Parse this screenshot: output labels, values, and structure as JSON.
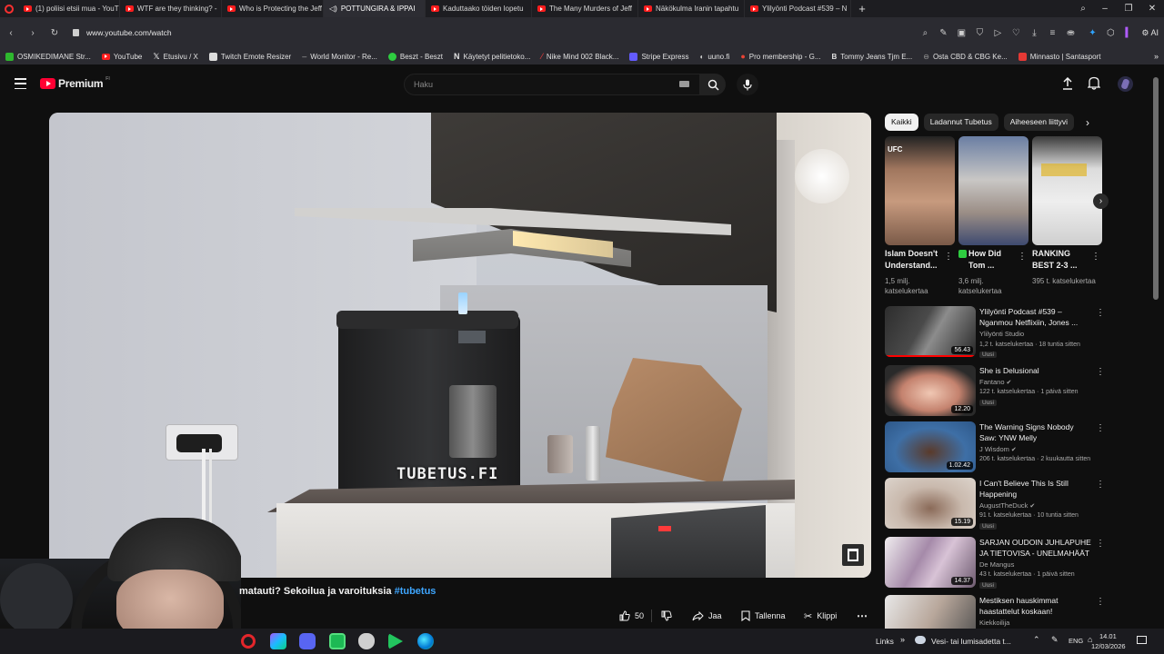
{
  "browser": {
    "tabs": [
      {
        "label": "(1) poliisi etsii mua - YouT",
        "active": false
      },
      {
        "label": "WTF are they thinking? -",
        "active": false
      },
      {
        "label": "Who is Protecting the Jeff",
        "active": false
      },
      {
        "label": "POTTUNGIRA & IPPAI",
        "active": true
      },
      {
        "label": "Kaduttaako töiden lopetu",
        "active": false
      },
      {
        "label": "The Many Murders of Jeff",
        "active": false
      },
      {
        "label": "Näkökulma Iranin tapahtu",
        "active": false
      },
      {
        "label": "Ylilyönti Podcast #539 – N",
        "active": false
      }
    ],
    "new_tab": "+",
    "url": "www.youtube.com/watch",
    "ai_label": "AI",
    "bookmarks": [
      {
        "label": "OSMIKEDIMANE Str...",
        "color": "#2eb82e"
      },
      {
        "label": "YouTube",
        "color": "#ff1d1d"
      },
      {
        "label": "Etusivu / X",
        "color": "#ffffff"
      },
      {
        "label": "Twitch Emote Resizer",
        "color": "#dddddd"
      },
      {
        "label": "World Monitor - Re...",
        "color": "#888888"
      },
      {
        "label": "Beszt - Beszt",
        "color": "#2ecc40"
      },
      {
        "label": "Käytetyt pelitietoko...",
        "color": "#ffffff"
      },
      {
        "label": "Nike Mind 002 Black...",
        "color": "#ff3b3b"
      },
      {
        "label": "Stripe Express",
        "color": "#635bff"
      },
      {
        "label": "uuno.fi",
        "color": "#cccccc"
      },
      {
        "label": "Pro membership - G...",
        "color": "#ea4335"
      },
      {
        "label": "Tommy Jeans Tjm E...",
        "color": "#ffffff"
      },
      {
        "label": "Osta CBD & CBG Ke...",
        "color": "#999999"
      },
      {
        "label": "Minnasto | Santasport",
        "color": "#e53935"
      }
    ]
  },
  "youtube": {
    "logo_text": "Premium",
    "logo_sup": "FI",
    "search_placeholder": "Haku",
    "video": {
      "overlay_text": "TUBETUS.FI",
      "title_prefix": "matauti? Sekoilua ja varoituksia",
      "title_hashtag": "#tubetus"
    },
    "actions": {
      "likes": "50",
      "share": "Jaa",
      "save": "Tallenna",
      "clip": "Klippi"
    },
    "chips": [
      "Kaikki",
      "Ladannut Tubetus",
      "Aiheeseen liittyvi"
    ],
    "shorts": [
      {
        "title": "Islam Doesn't Understand...",
        "views": "1,5 milj. katselukertaa"
      },
      {
        "title": "How Did Tom ...",
        "views": "3,6 milj. katselukertaa"
      },
      {
        "title": "RANKING BEST 2-3 ...",
        "views": "395 t. katselukertaa"
      }
    ],
    "recommended": [
      {
        "title": "Ylilyönti Podcast #539 – Nganmou Netflixiin, Jones ...",
        "channel": "Ylilyönti Studio",
        "meta": "1,2 t. katselukertaa · 18 tuntia sitten",
        "badge": "Uusi",
        "duration": "56.43",
        "thumb": "#3a3a3a"
      },
      {
        "title": "She is Delusional",
        "channel": "Fantano",
        "meta": "122 t. katselukertaa · 1 päivä sitten",
        "badge": "Uusi",
        "duration": "12.20",
        "thumb": "#b46a5c"
      },
      {
        "title": "The Warning Signs Nobody Saw: YNW Melly",
        "channel": "J Wisdom",
        "meta": "206 t. katselukertaa · 2 kuukautta sitten",
        "badge": "",
        "duration": "1.02.42",
        "thumb": "#3d6fa3"
      },
      {
        "title": "I Can't Believe This Is Still Happening",
        "channel": "AugustTheDuck",
        "meta": "91 t. katselukertaa · 10 tuntia sitten",
        "badge": "Uusi",
        "duration": "15.19",
        "thumb": "#7a6658"
      },
      {
        "title": "SARJAN OUDOIN JUHLAPUHE JA TIETOVISA - UNELMAHÄÄT",
        "channel": "De Mangus",
        "meta": "43 t. katselukertaa · 1 päivä sitten",
        "badge": "Uusi",
        "duration": "14.37",
        "thumb": "#8a6a8e"
      },
      {
        "title": "Mestiksen hauskimmat haastattelut koskaan!",
        "channel": "Kiekkoilija",
        "meta": "",
        "badge": "",
        "duration": "",
        "thumb": "#c9c9c9"
      }
    ]
  },
  "taskbar": {
    "links_label": "Links",
    "weather": "Vesi- tai lumisadetta t...",
    "language": "ENG",
    "time": "14.01",
    "date": "12/03/2026"
  }
}
